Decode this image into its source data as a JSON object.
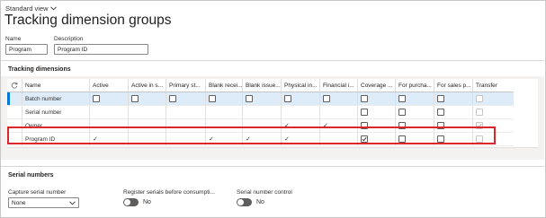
{
  "view": {
    "label": "Standard view",
    "chevron": "chevron-down-icon"
  },
  "page": {
    "title": "Tracking dimension groups"
  },
  "fields": {
    "name_label": "Name",
    "name_value": "Program",
    "description_label": "Description",
    "description_value": "Program ID"
  },
  "tracking": {
    "section_title": "Tracking dimensions",
    "columns": [
      "Name",
      "Active",
      "Active in s...",
      "Primary st...",
      "Blank recei...",
      "Blank issue...",
      "Physical in...",
      "Financial i...",
      "Coverage ...",
      "For purcha...",
      "For sales p...",
      "Transfer"
    ],
    "rows": [
      {
        "name": "Batch number",
        "active": false,
        "active_in_s": false,
        "primary_st": false,
        "blank_recei": false,
        "blank_issue": false,
        "physical": false,
        "financial": false,
        "coverage": false,
        "for_purcha": false,
        "for_sales": false,
        "transfer": false,
        "transfer_disabled": true,
        "selected": true
      },
      {
        "name": "Serial number",
        "active": "",
        "active_in_s": "",
        "primary_st": "",
        "blank_recei": "",
        "blank_issue": "",
        "physical": "",
        "financial": "",
        "coverage": false,
        "for_purcha": false,
        "for_sales": false,
        "transfer": false,
        "transfer_disabled": true,
        "selected": false
      },
      {
        "name": "Owner",
        "active": "",
        "active_in_s": "",
        "primary_st": "",
        "blank_recei": "",
        "blank_issue": "",
        "physical": "✓",
        "financial": "✓",
        "coverage": false,
        "for_purcha": false,
        "for_sales": false,
        "transfer": true,
        "transfer_disabled": true,
        "selected": false
      },
      {
        "name": "Program ID",
        "active": "✓",
        "active_in_s": "",
        "primary_st": "",
        "blank_recei": "✓",
        "blank_issue": "✓",
        "physical": "✓",
        "financial": "",
        "coverage": true,
        "for_purcha": false,
        "for_sales": false,
        "transfer": false,
        "transfer_disabled": true,
        "selected": false,
        "highlighted": true
      }
    ]
  },
  "serial": {
    "section_title": "Serial numbers",
    "capture_label": "Capture serial number",
    "capture_value": "None",
    "register_label": "Register serials before consumpti...",
    "register_value": "No",
    "control_label": "Serial number control",
    "control_value": "No"
  },
  "icons": {
    "refresh": "refresh-icon",
    "dropdown": "chevron-down-icon"
  },
  "colors": {
    "highlight": "#e0242c",
    "selected_row": "#deecf9",
    "selected_bar": "#0078d4"
  }
}
